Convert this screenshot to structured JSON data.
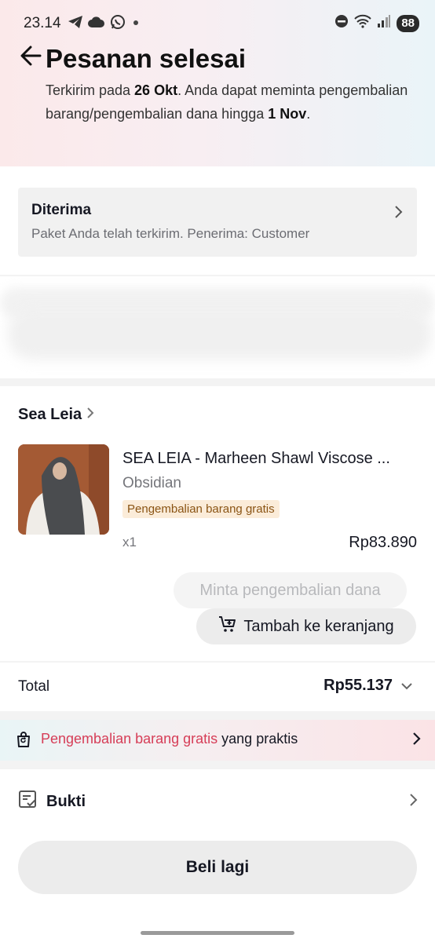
{
  "status_bar": {
    "time": "23.14",
    "battery": "88",
    "icons_left": [
      "telegram-icon",
      "cloud-icon",
      "whatsapp-icon",
      "dot-icon"
    ],
    "icons_right": [
      "dnd-icon",
      "wifi-icon",
      "signal-icon"
    ]
  },
  "header": {
    "title": "Pesanan selesai",
    "subtitle_prefix": "Terkirim pada ",
    "delivered_date": "26 Okt",
    "subtitle_middle": ". Anda dapat meminta pengembalian barang/pengembalian dana hingga ",
    "return_deadline": "1 Nov",
    "subtitle_suffix": "."
  },
  "delivery_status": {
    "title": "Diterima",
    "description": "Paket Anda telah terkirim. Penerima: Customer"
  },
  "order": {
    "store_name": "Sea Leia",
    "product_title": "SEA LEIA - Marheen Shawl Viscose ...",
    "variant": "Obsidian",
    "badge": "Pengembalian barang gratis",
    "quantity": "x1",
    "price": "Rp83.890",
    "refund_button": "Minta pengembalian dana",
    "add_to_cart_button": "Tambah ke keranjang"
  },
  "total": {
    "label": "Total",
    "value": "Rp55.137"
  },
  "promo": {
    "highlight": "Pengembalian barang gratis",
    "rest": " yang praktis"
  },
  "proof": {
    "label": "Bukti"
  },
  "buy_again_button": "Beli lagi",
  "colors": {
    "accent_pink": "#d63d57",
    "badge_bg": "#fbecd9",
    "badge_text": "#8a5414"
  }
}
